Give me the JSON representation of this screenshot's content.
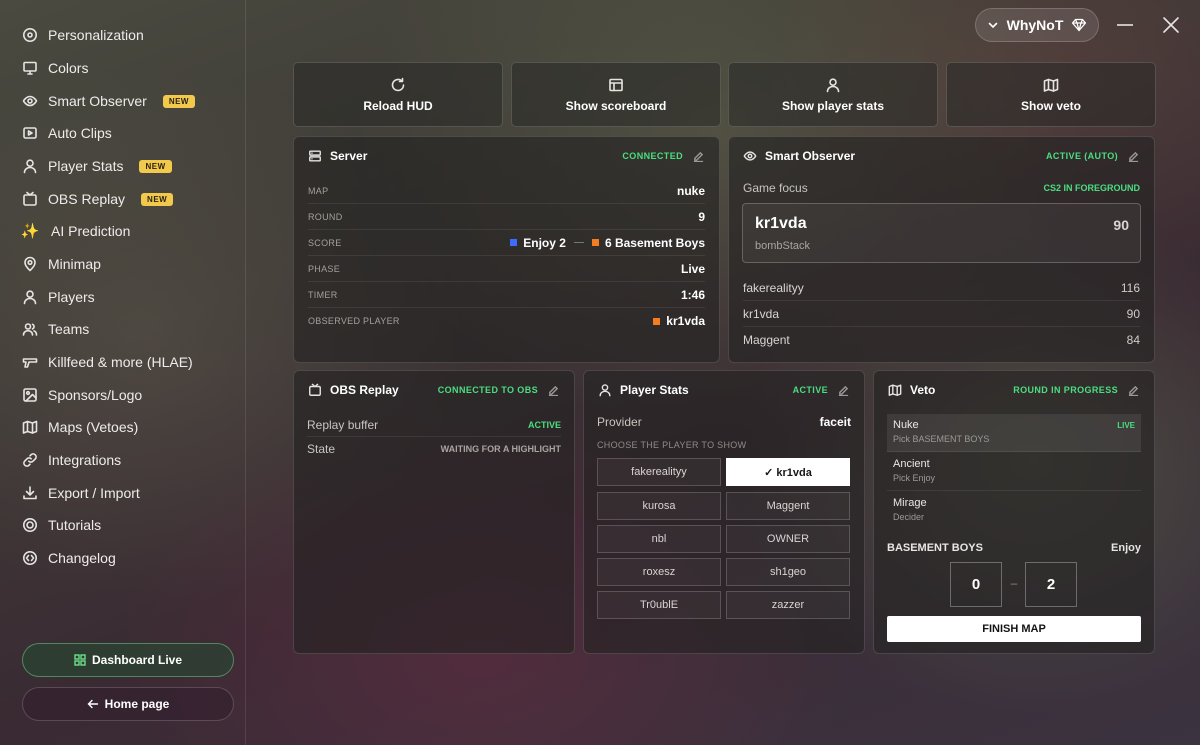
{
  "sidebar": {
    "items": [
      {
        "label": "Personalization",
        "icon": "palette-icon"
      },
      {
        "label": "Colors",
        "icon": "monitor-icon"
      },
      {
        "label": "Smart Observer",
        "icon": "eye-icon",
        "badge": "NEW"
      },
      {
        "label": "Auto Clips",
        "icon": "clip-icon"
      },
      {
        "label": "Player Stats",
        "icon": "user-icon",
        "badge": "NEW"
      },
      {
        "label": "OBS Replay",
        "icon": "replay-icon",
        "badge": "NEW"
      },
      {
        "label": "AI Prediction",
        "icon": "sparkle-icon"
      },
      {
        "label": "Minimap",
        "icon": "map-pin-icon"
      },
      {
        "label": "Players",
        "icon": "user-icon"
      },
      {
        "label": "Teams",
        "icon": "users-icon"
      },
      {
        "label": "Killfeed & more (HLAE)",
        "icon": "gun-icon"
      },
      {
        "label": "Sponsors/Logo",
        "icon": "image-icon"
      },
      {
        "label": "Maps (Vetoes)",
        "icon": "map-icon"
      },
      {
        "label": "Integrations",
        "icon": "link-icon"
      },
      {
        "label": "Export / Import",
        "icon": "download-icon"
      },
      {
        "label": "Tutorials",
        "icon": "target-icon"
      },
      {
        "label": "Changelog",
        "icon": "changelog-icon"
      }
    ],
    "dashboard_label": "Dashboard Live",
    "home_label": "Home page"
  },
  "account": {
    "name": "WhyNoT"
  },
  "actions": [
    {
      "label": "Reload HUD",
      "icon": "reload-icon"
    },
    {
      "label": "Show scoreboard",
      "icon": "scoreboard-icon"
    },
    {
      "label": "Show player stats",
      "icon": "user-icon"
    },
    {
      "label": "Show veto",
      "icon": "map-icon"
    }
  ],
  "server": {
    "title": "Server",
    "status": "CONNECTED",
    "rows": [
      {
        "label": "MAP",
        "value": "nuke"
      },
      {
        "label": "ROUND",
        "value": "9"
      },
      {
        "label": "SCORE",
        "team1": "Enjoy 2",
        "team2": "6 Basement Boys"
      },
      {
        "label": "PHASE",
        "value": "Live"
      },
      {
        "label": "TIMER",
        "value": "1:46"
      },
      {
        "label": "OBSERVED PLAYER",
        "value": "kr1vda"
      }
    ]
  },
  "smart_observer": {
    "title": "Smart Observer",
    "status": "ACTIVE (AUTO)",
    "focus_label": "Game focus",
    "focus_status": "CS2 IN FOREGROUND",
    "focused": {
      "name": "kr1vda",
      "sub": "bombStack",
      "score": "90"
    },
    "rows": [
      {
        "name": "fakerealityy",
        "score": "116"
      },
      {
        "name": "kr1vda",
        "score": "90"
      },
      {
        "name": "Maggent",
        "score": "84"
      }
    ]
  },
  "obs_replay": {
    "title": "OBS Replay",
    "status": "CONNECTED TO OBS",
    "rows": [
      {
        "label": "Replay buffer",
        "value": "ACTIVE"
      },
      {
        "label": "State",
        "value": "WAITING FOR A HIGHLIGHT"
      }
    ]
  },
  "player_stats": {
    "title": "Player Stats",
    "status": "ACTIVE",
    "provider_label": "Provider",
    "provider_value": "faceit",
    "choose_label": "CHOOSE THE PLAYER TO SHOW",
    "players": [
      "fakerealityy",
      "✓ kr1vda",
      "kurosa",
      "Maggent",
      "nbl",
      "OWNER",
      "roxesz",
      "sh1geo",
      "Tr0ublE",
      "zazzer"
    ]
  },
  "veto": {
    "title": "Veto",
    "status": "ROUND IN PROGRESS",
    "maps": [
      {
        "map": "Nuke",
        "sub": "Pick BASEMENT BOYS",
        "live": "LIVE"
      },
      {
        "map": "Ancient",
        "sub": "Pick Enjoy"
      },
      {
        "map": "Mirage",
        "sub": "Decider"
      }
    ],
    "team_left": "BASEMENT BOYS",
    "team_right": "Enjoy",
    "score_left": "0",
    "score_sep": "–",
    "score_right": "2",
    "finish_label": "FINISH MAP"
  },
  "colors": {
    "accent_green": "#4ade80",
    "badge_yellow": "#f2c94c",
    "team_blue": "#3b6bff",
    "team_orange": "#f57c1f"
  }
}
